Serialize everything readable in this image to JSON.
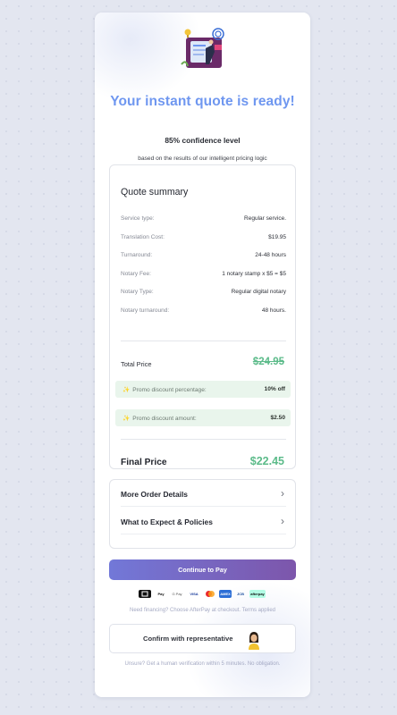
{
  "header": {
    "title": "Your instant quote is ready!",
    "confidence": "85% confidence level",
    "subtitle": "based on the results of our intelligent pricing logic"
  },
  "summary": {
    "title": "Quote summary",
    "rows": [
      {
        "label": "Service type:",
        "value": "Regular service."
      },
      {
        "label": "Translation Cost:",
        "value": "$19.95"
      },
      {
        "label": "Turnaround:",
        "value": "24-48 hours"
      },
      {
        "label": "Notary Fee:",
        "value": "1 notary stamp x $5 = $5"
      },
      {
        "label": "Notary Type:",
        "value": "Regular digital notary"
      },
      {
        "label": "Notary turnaround:",
        "value": "48 hours."
      }
    ],
    "total_label": "Total Price",
    "total_value": "$24.95",
    "promos": [
      {
        "label": "Promo discount percentage:",
        "value": "10% off"
      },
      {
        "label": "Promo discount amount:",
        "value": "$2.50"
      }
    ],
    "final_label": "Final Price",
    "final_value": "$22.45"
  },
  "details": {
    "items": [
      {
        "label": "More Order Details"
      },
      {
        "label": "What to Expect & Policies"
      }
    ]
  },
  "payment": {
    "button_label": "Continue to Pay",
    "methods": [
      "card-reader-icon",
      "Pay",
      "G Pay",
      "VISA",
      "mastercard-icon",
      "AMEX",
      "JCB",
      "afterpay"
    ],
    "financing_note": "Need financing? Choose AfterPay at checkout. Terms applied"
  },
  "representative": {
    "button_label": "Confirm with representative",
    "note": "Unsure? Get a human verification within 5 minutes. No obligation."
  },
  "colors": {
    "title": "#6f97f0",
    "price_green": "#5cbb8a",
    "promo_bg": "#e9f5ec",
    "button_start": "#7278d8",
    "button_end": "#7d56ab"
  }
}
